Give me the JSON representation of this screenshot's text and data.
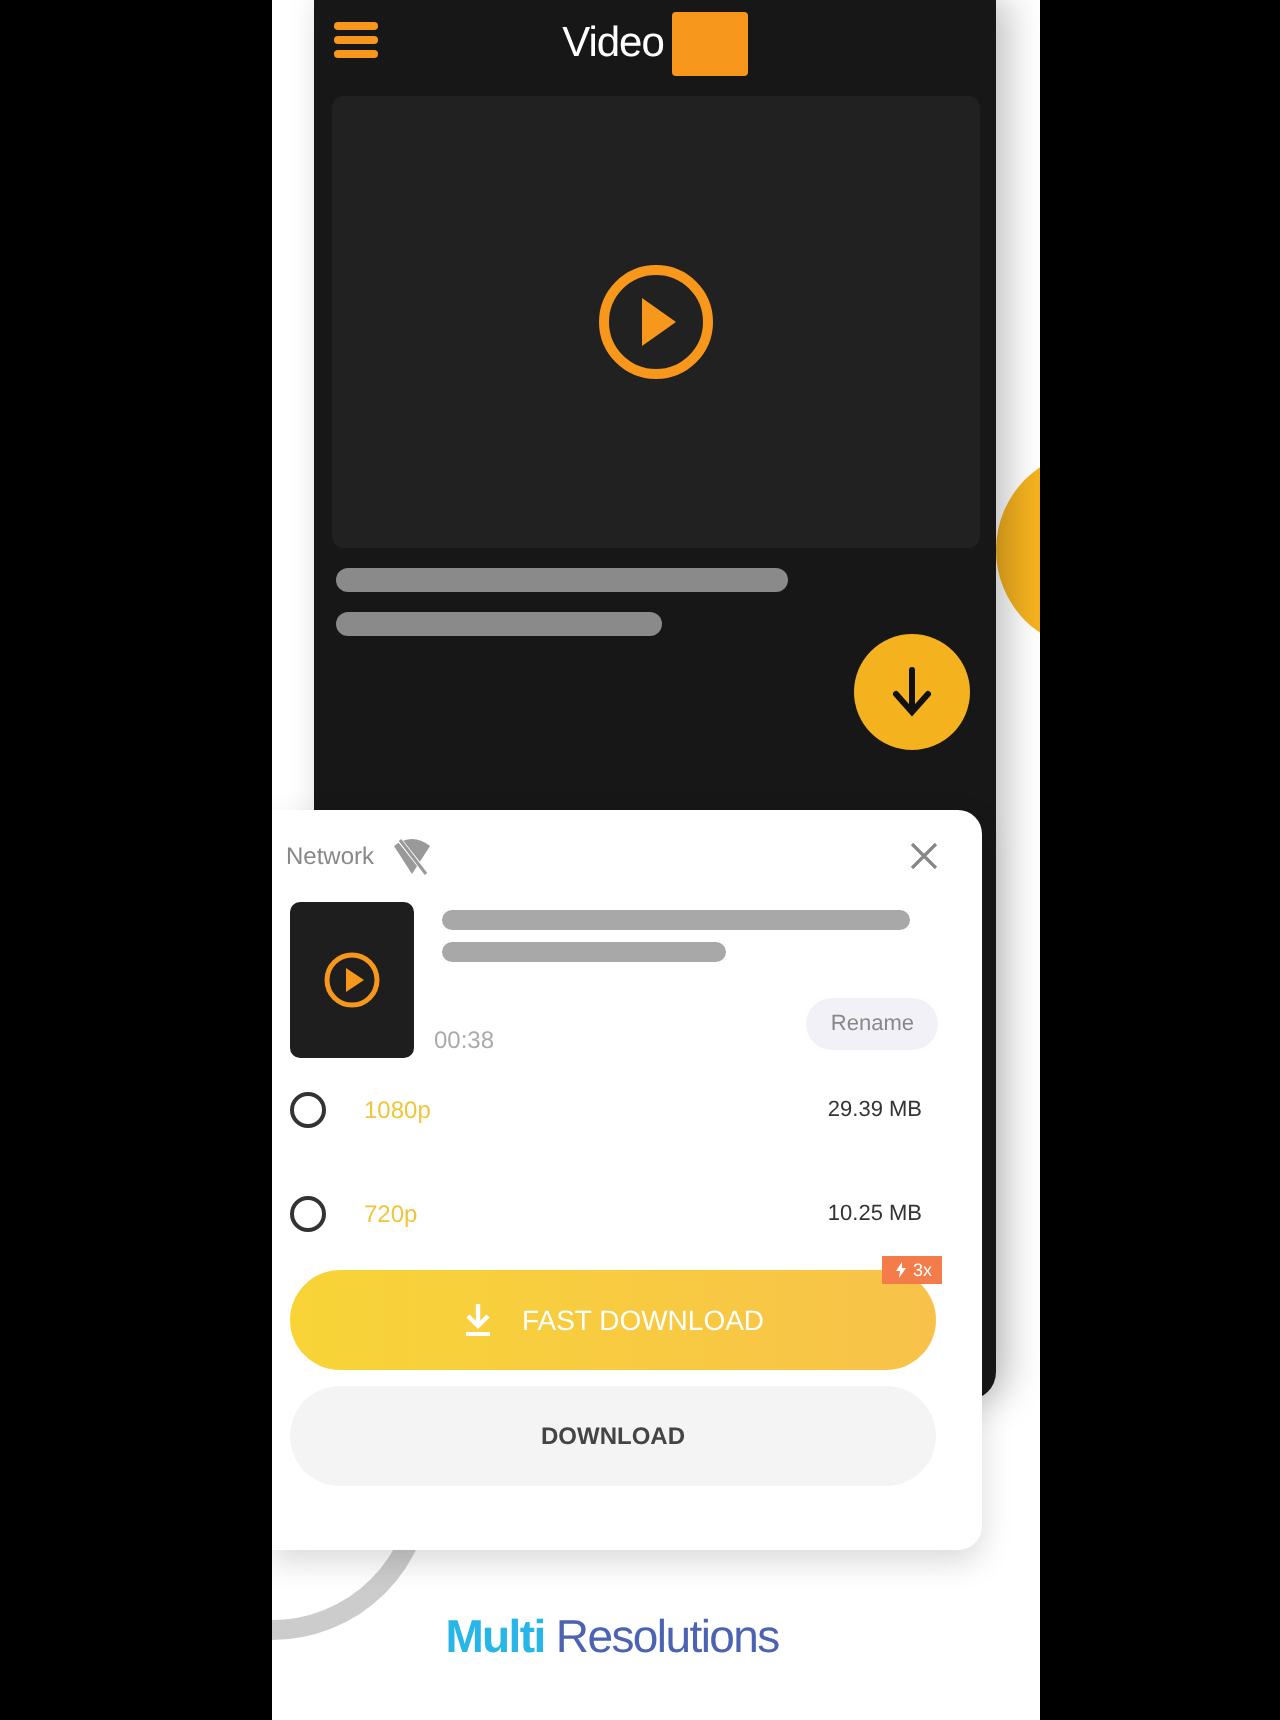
{
  "app_bar": {
    "title": "Video"
  },
  "sheet": {
    "network_label": "Network",
    "duration": "00:38",
    "rename_button": "Rename",
    "resolutions": [
      {
        "label": "1080p",
        "size": "29.39 MB",
        "selected": false
      },
      {
        "label": "720p",
        "size": "10.25 MB",
        "selected": false
      }
    ],
    "fast_download_button": "FAST DOWNLOAD",
    "speed_badge": "3x",
    "download_button": "DOWNLOAD"
  },
  "caption": "**Multi** Resolutions"
}
